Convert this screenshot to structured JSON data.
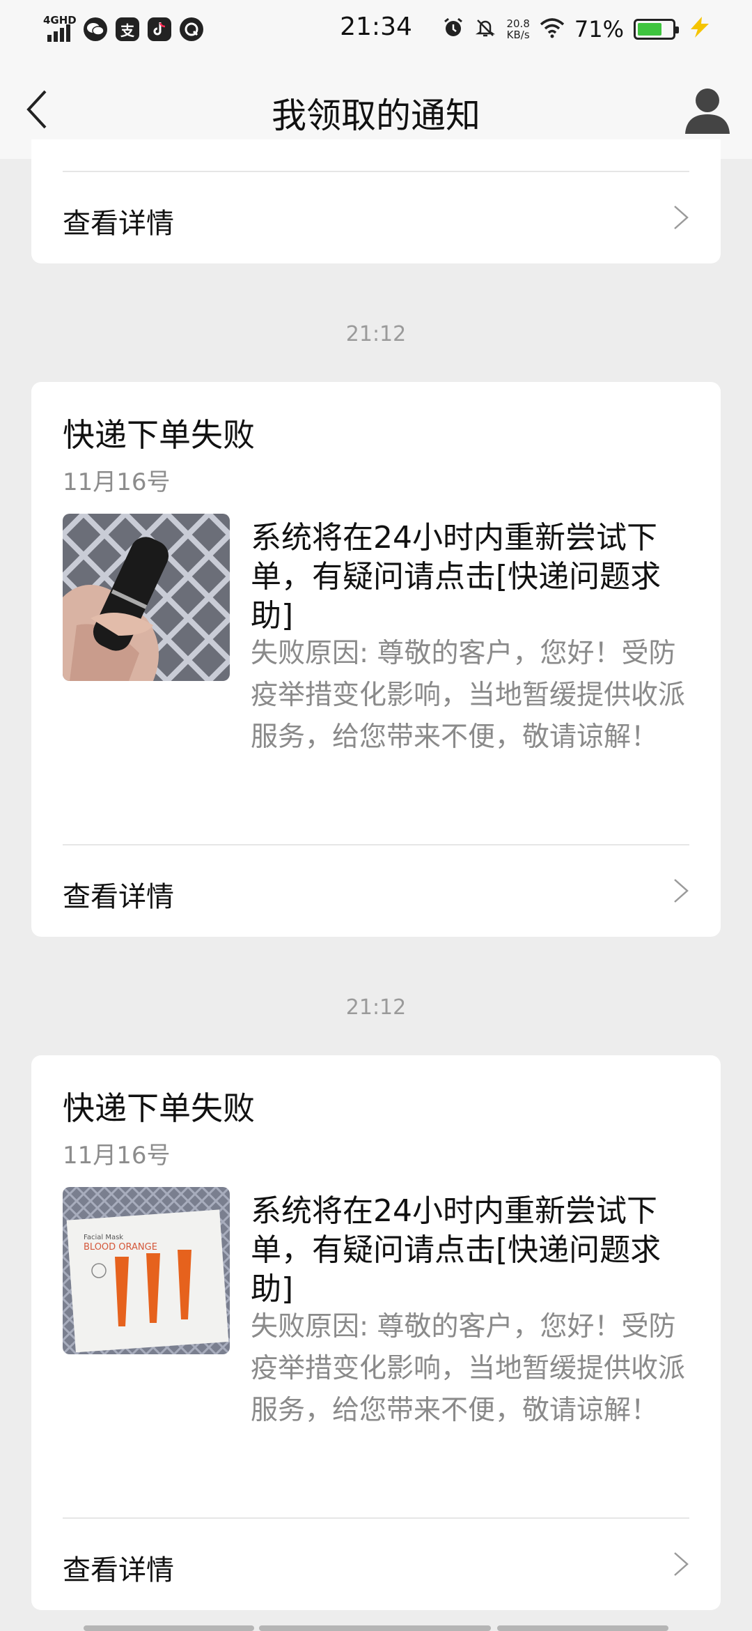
{
  "status_bar": {
    "network": "4GHD",
    "app_icons": [
      "wechat-icon",
      "alipay-icon",
      "tiktok-icon",
      "browser-icon"
    ],
    "alipay_glyph": "支",
    "time": "21:34",
    "speed_value": "20.8",
    "speed_unit": "KB/s",
    "battery_percent": "71%",
    "battery_level": 0.71
  },
  "header": {
    "title": "我领取的通知"
  },
  "cards": [
    {
      "detail_label": "查看详情"
    },
    {
      "timestamp": "21:12",
      "title": "快递下单失败",
      "date": "11月16号",
      "main_text": "系统将在24小时内重新尝试下单，有疑问请点击[快递问题求助]",
      "reason": "失败原因: 尊敬的客户，您好！受防疫举措变化影响，当地暂缓提供收派服务，给您带来不便，敬请谅解！",
      "detail_label": "查看详情",
      "image": "lipstick-photo"
    },
    {
      "timestamp": "21:12",
      "title": "快递下单失败",
      "date": "11月16号",
      "main_text": "系统将在24小时内重新尝试下单，有疑问请点击[快递问题求助]",
      "reason": "失败原因: 尊敬的客户，您好！受防疫举措变化影响，当地暂缓提供收派服务，给您带来不便，敬请谅解！",
      "detail_label": "查看详情",
      "image": "facial-mask-photo",
      "image_text": "BLOOD ORANGE"
    }
  ],
  "colors": {
    "background": "#ededed",
    "card": "#ffffff",
    "secondary_text": "#8a8a8a"
  }
}
